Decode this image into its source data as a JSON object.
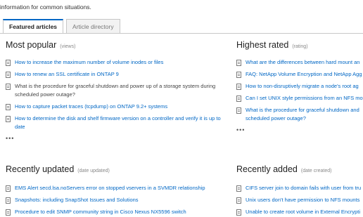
{
  "intro_text": "information for common situations.",
  "tabs": [
    {
      "label": "Featured articles",
      "active": true
    },
    {
      "label": "Article directory",
      "active": false
    }
  ],
  "sections": {
    "most_popular": {
      "title": "Most popular",
      "subtitle": "(views)",
      "items": [
        "How to increase the maximum number of volume inodes or files",
        "How to renew an SSL certificate in ONTAP 9",
        "What is the procedure for graceful shutdown and power up of a storage system during scheduled power outage?",
        "How to capture packet traces (tcpdump) on ONTAP 9.2+ systems",
        "How to determine the disk and shelf firmware version on a controller and verify it is up to date"
      ],
      "more": "•••"
    },
    "highest_rated": {
      "title": "Highest rated",
      "subtitle": "(rating)",
      "items": [
        "What are the differences between hard mount an",
        "FAQ: NetApp Volume Encryption and NetApp Agg",
        "How to non-disruptively migrate a node's root ag",
        "Can I set UNIX style permissions from an NFS mou",
        "What is the procedure for graceful shutdown and scheduled power outage?"
      ],
      "more": "•••"
    },
    "recently_updated": {
      "title": "Recently updated",
      "subtitle": "(date updated)",
      "items": [
        "EMS Alert secd.lsa.noServers error on stopped vservers in a SVMDR relationship",
        "Snapshots: including SnapShot Issues and Solutions",
        "Procedure to edit SNMP community string in Cisco Nexus NX5596 switch"
      ]
    },
    "recently_added": {
      "title": "Recently added",
      "subtitle": "(date created)",
      "items": [
        "CIFS server join to domain fails with user from tru",
        "Unix users don't have permission to NFS mounts",
        "Unable to create root volume in External Encrypti"
      ]
    }
  }
}
